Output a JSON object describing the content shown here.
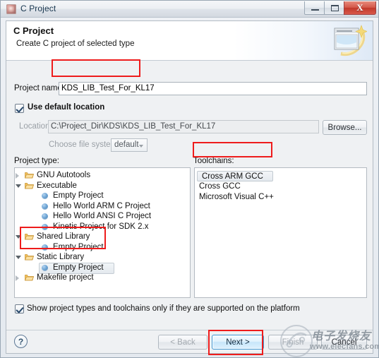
{
  "window": {
    "title": "C Project",
    "title_icon": "c-project-icon",
    "caption": {
      "minimize": "minimize-icon",
      "maximize": "maximize-icon",
      "close_glyph": "X"
    }
  },
  "banner": {
    "title": "C Project",
    "subtitle": "Create C project of selected type",
    "icon": "new-project-wizard-icon"
  },
  "form": {
    "project_name_label": "Project name:",
    "project_name_value": "KDS_LIB_Test_For_KL17",
    "use_default_location_label": "Use default location",
    "use_default_location_checked": true,
    "location_label": "Location:",
    "location_value": "C:\\Project_Dir\\KDS\\KDS_LIB_Test_For_KL17",
    "browse_label": "Browse...",
    "choose_file_system_label": "Choose file system:",
    "file_system_value": "default"
  },
  "project_type": {
    "label": "Project type:",
    "items": [
      {
        "label": "GNU Autotools",
        "kind": "folder",
        "state": "collapsed",
        "indent": 0
      },
      {
        "label": "Executable",
        "kind": "folder",
        "state": "expanded",
        "indent": 0
      },
      {
        "label": "Empty Project",
        "kind": "leaf",
        "state": "none",
        "indent": 1
      },
      {
        "label": "Hello World ARM C Project",
        "kind": "leaf",
        "state": "none",
        "indent": 1
      },
      {
        "label": "Hello World ANSI C Project",
        "kind": "leaf",
        "state": "none",
        "indent": 1
      },
      {
        "label": "Kinetis Project for SDK 2.x",
        "kind": "leaf",
        "state": "none",
        "indent": 1
      },
      {
        "label": "Shared Library",
        "kind": "folder",
        "state": "expanded",
        "indent": 0
      },
      {
        "label": "Empty Project",
        "kind": "leaf",
        "state": "none",
        "indent": 1
      },
      {
        "label": "Static Library",
        "kind": "folder",
        "state": "expanded",
        "indent": 0
      },
      {
        "label": "Empty Project",
        "kind": "leaf",
        "state": "none",
        "indent": 1,
        "selected": true
      },
      {
        "label": "Makefile project",
        "kind": "folder",
        "state": "collapsed",
        "indent": 0
      }
    ]
  },
  "toolchains": {
    "label": "Toolchains:",
    "items": [
      {
        "label": "Cross ARM GCC",
        "selected": true
      },
      {
        "label": "Cross GCC",
        "selected": false
      },
      {
        "label": "Microsoft Visual C++",
        "selected": false
      }
    ]
  },
  "options": {
    "show_supported_label": "Show project types and toolchains only if they are supported on the platform",
    "show_supported_checked": true
  },
  "footer": {
    "help_glyph": "?",
    "back_label": "< Back",
    "next_label": "Next >",
    "finish_label": "Finish",
    "cancel_label": "Cancel"
  },
  "watermark": {
    "chinese": "电子发烧友",
    "url": "www.elecfans.com"
  },
  "annotations": {
    "highlight_color": "#ee1c1c",
    "boxes": [
      {
        "name": "project-name-highlight"
      },
      {
        "name": "static-library-highlight"
      },
      {
        "name": "cross-arm-gcc-highlight"
      },
      {
        "name": "next-button-highlight"
      }
    ]
  }
}
